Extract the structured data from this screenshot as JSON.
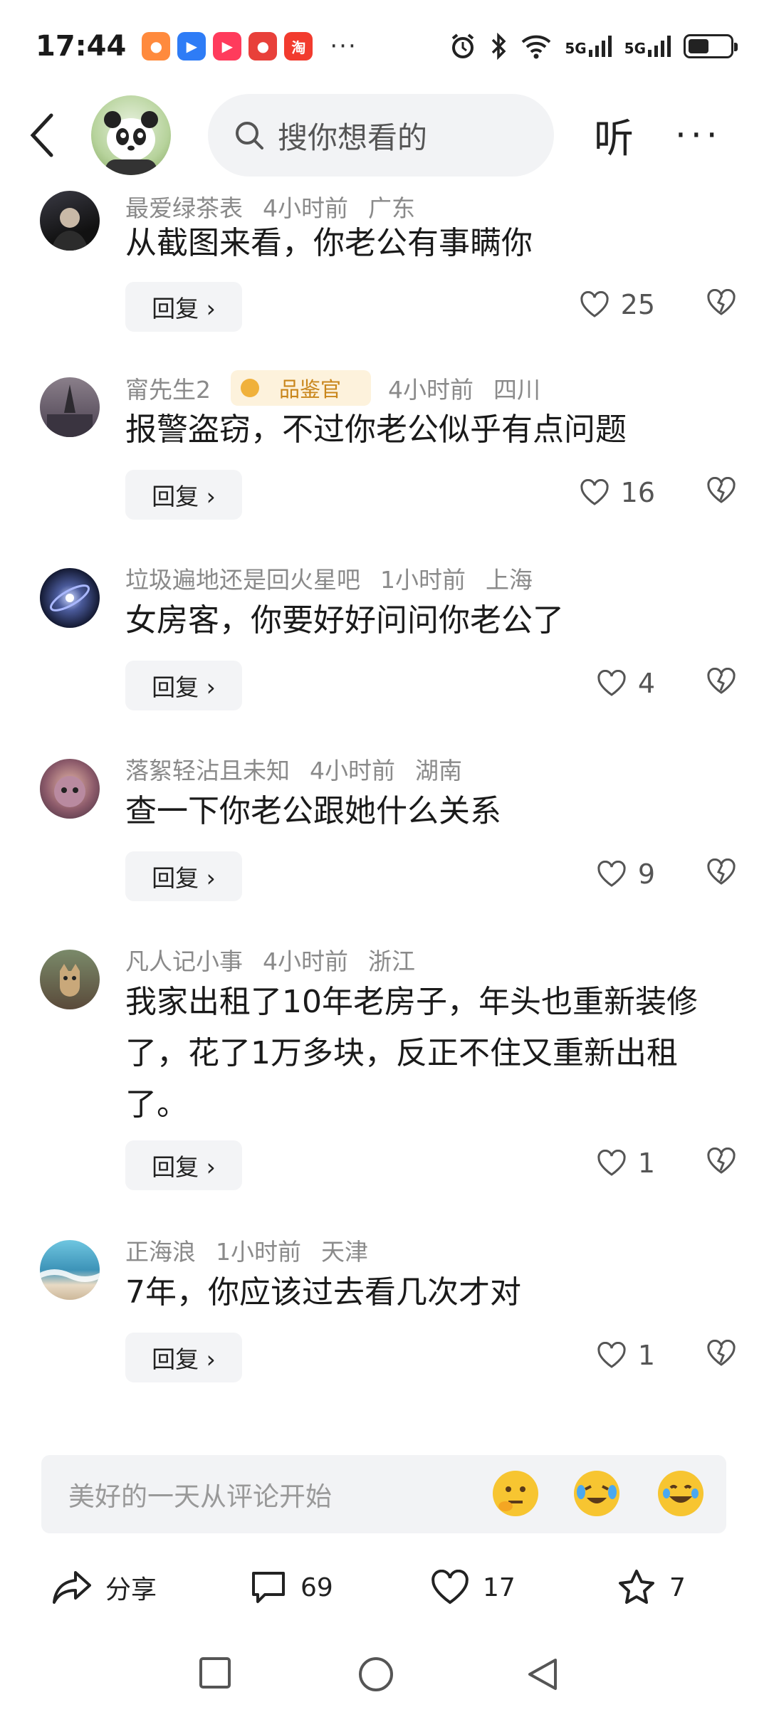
{
  "status_bar": {
    "time": "17:44",
    "app_icons": [
      {
        "name": "app-icon-1",
        "color": "#ff8a3d",
        "glyph": "●"
      },
      {
        "name": "app-icon-2",
        "color": "#2e7cf6",
        "glyph": "▶"
      },
      {
        "name": "app-icon-3",
        "color": "#ff3b5c",
        "glyph": "▶"
      },
      {
        "name": "app-icon-4",
        "color": "#e8403a",
        "glyph": "●"
      },
      {
        "name": "app-icon-5",
        "color": "#f23b2e",
        "glyph": "淘"
      }
    ],
    "overflow": "···",
    "signal_1": "5G",
    "signal_2": "5G",
    "battery_level": 0.5
  },
  "header": {
    "search_placeholder": "搜你想看的",
    "listen_label": "听",
    "more_label": "···"
  },
  "comments": [
    {
      "user": "最爱绿茶表",
      "badge": "",
      "time": "4小时前",
      "location": "广东",
      "text": "从截图来看，你老公有事瞒你",
      "reply": "回复 ›",
      "likes": "25"
    },
    {
      "user": "甯先生2",
      "badge": "品鉴官",
      "time": "4小时前",
      "location": "四川",
      "text": "报警盗窃，不过你老公似乎有点问题",
      "reply": "回复 ›",
      "likes": "16"
    },
    {
      "user": "垃圾遍地还是回火星吧",
      "badge": "",
      "time": "1小时前",
      "location": "上海",
      "text": "女房客，你要好好问问你老公了",
      "reply": "回复 ›",
      "likes": "4"
    },
    {
      "user": "落絮轻沾且未知",
      "badge": "",
      "time": "4小时前",
      "location": "湖南",
      "text": "查一下你老公跟她什么关系",
      "reply": "回复 ›",
      "likes": "9"
    },
    {
      "user": "凡人记小事",
      "badge": "",
      "time": "4小时前",
      "location": "浙江",
      "text": "我家出租了10年老房子，年头也重新装修了，花了1万多块，反正不住又重新出租了。",
      "reply": "回复 ›",
      "likes": "1"
    },
    {
      "user": "正海浪",
      "badge": "",
      "time": "1小时前",
      "location": "天津",
      "text": "7年，你应该过去看几次才对",
      "reply": "回复 ›",
      "likes": "1"
    }
  ],
  "input": {
    "placeholder": "美好的一天从评论开始"
  },
  "actions": {
    "share_label": "分享",
    "comments_count": "69",
    "likes_count": "17",
    "favorites_count": "7"
  }
}
